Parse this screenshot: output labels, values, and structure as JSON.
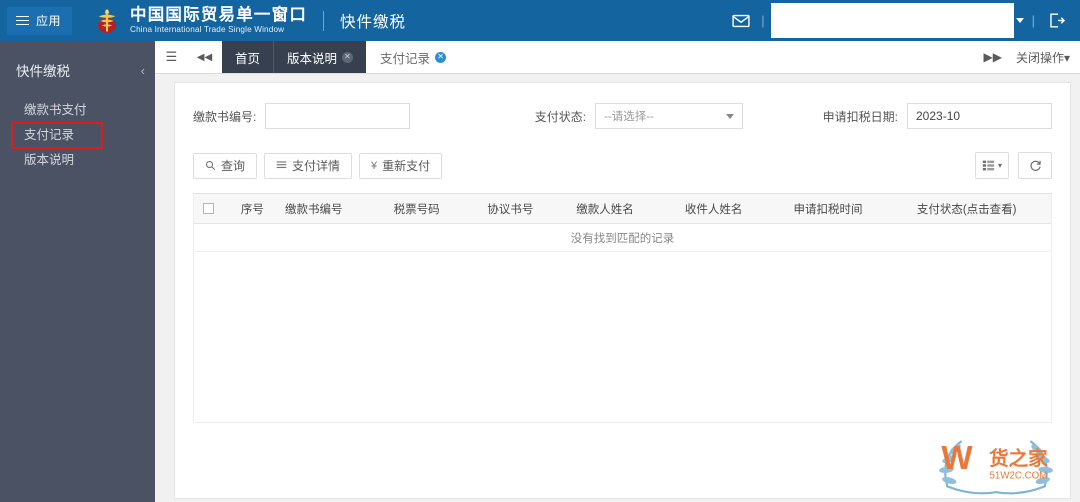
{
  "header": {
    "app_menu_label": "应用",
    "menu_icon": "hamburger-icon",
    "emblem_icon": "customs-emblem-icon",
    "brand_cn": "中国国际贸易单一窗口",
    "brand_en": "China International Trade Single Window",
    "divider": "|",
    "module_title": "快件缴税",
    "mail_icon": "mail-icon",
    "separator": "|",
    "user_name": "",
    "logout_icon": "logout-icon",
    "bg_color": "#1464a0"
  },
  "sidebar": {
    "title": "快件缴税",
    "collapse_icon": "chevron-left-icon",
    "collapse_glyph": "‹",
    "bg_color": "#4a5264",
    "highlight_color": "#e01b1b",
    "items": [
      {
        "label": "缴款书支付",
        "highlighted": false
      },
      {
        "label": "支付记录",
        "highlighted": true
      },
      {
        "label": "版本说明",
        "highlighted": false
      }
    ]
  },
  "tabbar": {
    "menu_icon": "list-icon",
    "menu_glyph": "☰",
    "prev_icon": "rewind-icon",
    "prev_glyph": "◀◀",
    "next_icon": "fast-forward-icon",
    "next_glyph": "▶▶",
    "tabs": [
      {
        "label": "首页",
        "style": "dark",
        "closable": false
      },
      {
        "label": "版本说明",
        "style": "dark",
        "closable": true
      },
      {
        "label": "支付记录",
        "style": "active",
        "closable": true
      }
    ],
    "close_glyph": "✕",
    "operations_label": "关闭操作",
    "operations_caret": "▾"
  },
  "form": {
    "fields": [
      {
        "label": "缴款书编号:",
        "type": "text",
        "value": "",
        "placeholder": ""
      },
      {
        "label": "支付状态:",
        "type": "select",
        "value": "--请选择--",
        "options": [
          "--请选择--"
        ]
      },
      {
        "label": "申请扣税日期:",
        "type": "date",
        "value": "2023-10",
        "placeholder": ""
      }
    ]
  },
  "toolbar": {
    "buttons": [
      {
        "label": "查询",
        "icon": "search-icon",
        "glyph": "🔍"
      },
      {
        "label": "支付详情",
        "icon": "list-detail-icon",
        "glyph": "☰"
      },
      {
        "label": "重新支付",
        "icon": "yuan-icon",
        "glyph": "¥"
      }
    ],
    "columns_button": {
      "icon": "columns-icon",
      "caret": "▾"
    },
    "refresh_button": {
      "icon": "refresh-icon",
      "glyph": "⟳"
    }
  },
  "table": {
    "select_all_checkbox": "unchecked",
    "columns": [
      "序号",
      "缴款书编号",
      "税票号码",
      "协议书号",
      "缴款人姓名",
      "收件人姓名",
      "申请扣税时间",
      "支付状态(点击查看)"
    ],
    "rows": [],
    "empty_message": "没有找到匹配的记录"
  },
  "watermark": {
    "letter": "W",
    "name_cn": "货之家",
    "domain": "51W2C.COM",
    "letter_color": "#e8793a",
    "laurel_color": "#6aa8cc"
  }
}
